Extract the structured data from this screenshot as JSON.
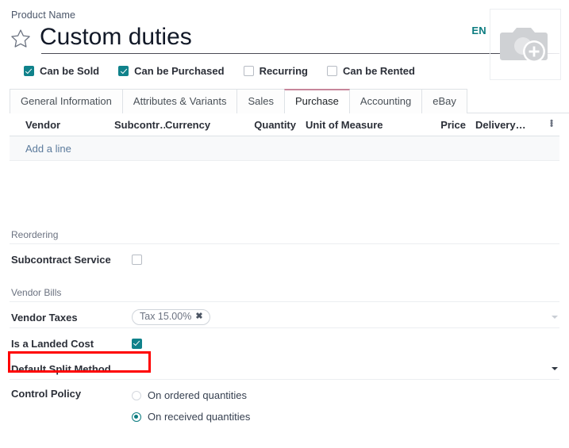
{
  "header": {
    "field_label": "Product Name",
    "title": "Custom duties",
    "lang_badge": "EN",
    "star_icon": "star-outline-icon",
    "image_icon": "camera-add-photo-icon"
  },
  "flags": [
    {
      "label": "Can be Sold",
      "checked": true
    },
    {
      "label": "Can be Purchased",
      "checked": true
    },
    {
      "label": "Recurring",
      "checked": false
    },
    {
      "label": "Can be Rented",
      "checked": false
    }
  ],
  "tabs": [
    {
      "label": "General Information",
      "active": false
    },
    {
      "label": "Attributes & Variants",
      "active": false
    },
    {
      "label": "Sales",
      "active": false
    },
    {
      "label": "Purchase",
      "active": true
    },
    {
      "label": "Accounting",
      "active": false
    },
    {
      "label": "eBay",
      "active": false
    }
  ],
  "vendor_list": {
    "columns": {
      "vendor": "Vendor",
      "subcontractor": "Subcontr…",
      "currency": "Currency",
      "quantity": "Quantity",
      "uom": "Unit of Measure",
      "price": "Price",
      "delivery": "Delivery…"
    },
    "optional_columns_icon": "vertical-dots-icon",
    "add_line": "Add a line",
    "rows": []
  },
  "sections": {
    "reordering": {
      "title": "Reordering",
      "subcontract_service": {
        "label": "Subcontract Service",
        "checked": false
      }
    },
    "vendor_bills": {
      "title": "Vendor Bills",
      "vendor_taxes": {
        "label": "Vendor Taxes",
        "tags": [
          {
            "text": "Tax 15.00%",
            "remove_icon": "✖"
          }
        ]
      },
      "is_landed_cost": {
        "label": "Is a Landed Cost",
        "checked": true
      },
      "default_split_method": {
        "label": "Default Split Method",
        "value": ""
      },
      "control_policy": {
        "label": "Control Policy",
        "options": [
          {
            "label": "On ordered quantities",
            "selected": false
          },
          {
            "label": "On received quantities",
            "selected": true
          }
        ]
      }
    }
  },
  "annotation": {
    "highlight_color": "#ff0000",
    "target": "Is a Landed Cost"
  },
  "colors": {
    "accent_teal": "#10828b",
    "active_tab_border": "#c7869b",
    "link_blue": "#5c7b9c"
  }
}
